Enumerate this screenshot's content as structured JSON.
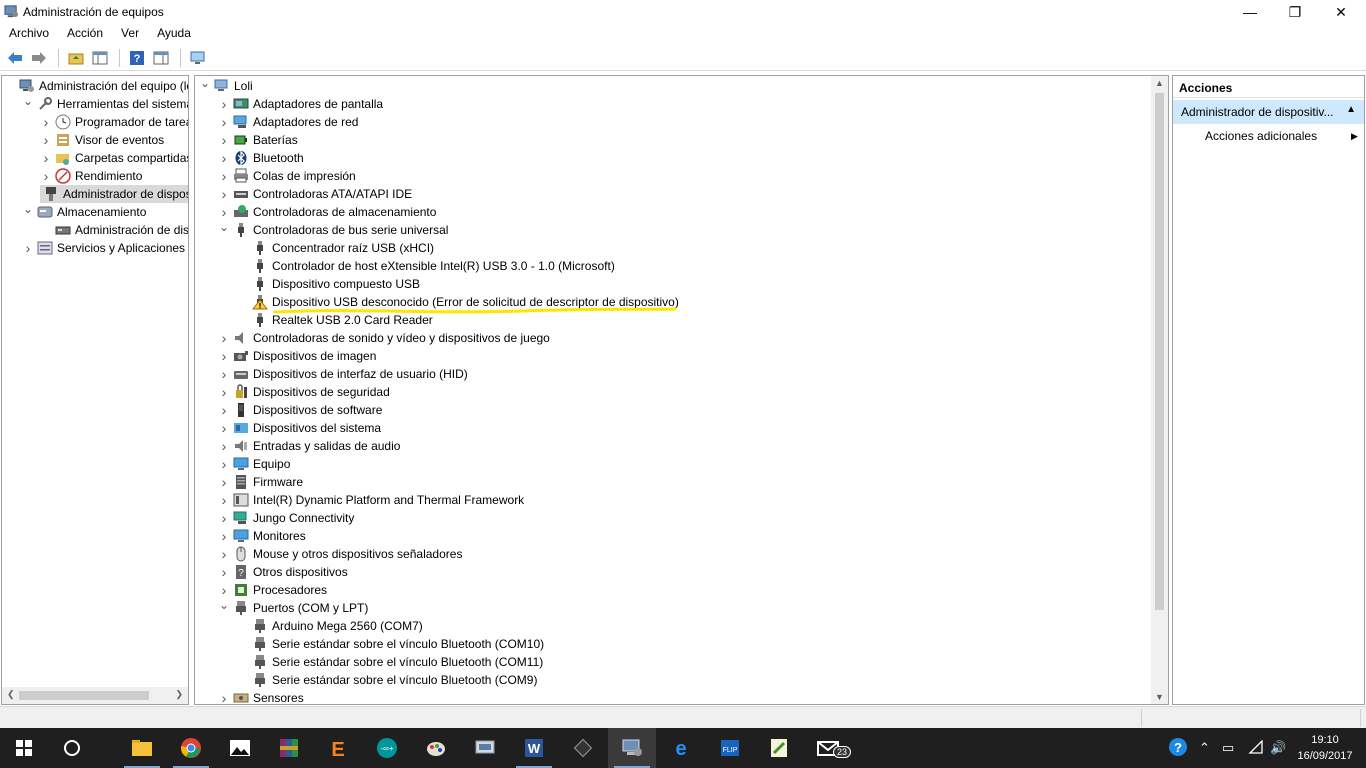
{
  "window": {
    "title": "Administración de equipos"
  },
  "menu": [
    "Archivo",
    "Acción",
    "Ver",
    "Ayuda"
  ],
  "left_tree": [
    {
      "label": "Administración del equipo (local)",
      "level": 0,
      "expander": "",
      "icon": "computer-management-icon"
    },
    {
      "label": "Herramientas del sistema",
      "level": 1,
      "expander": "open",
      "icon": "tools-icon"
    },
    {
      "label": "Programador de tareas",
      "level": 2,
      "expander": "closed",
      "icon": "clock-icon"
    },
    {
      "label": "Visor de eventos",
      "level": 2,
      "expander": "closed",
      "icon": "event-viewer-icon"
    },
    {
      "label": "Carpetas compartidas",
      "level": 2,
      "expander": "closed",
      "icon": "shared-folder-icon"
    },
    {
      "label": "Rendimiento",
      "level": 2,
      "expander": "closed",
      "icon": "performance-icon"
    },
    {
      "label": "Administrador de dispositivos",
      "level": 2,
      "expander": "",
      "icon": "device-manager-icon",
      "selected": true
    },
    {
      "label": "Almacenamiento",
      "level": 1,
      "expander": "open",
      "icon": "storage-icon"
    },
    {
      "label": "Administración de discos",
      "level": 2,
      "expander": "",
      "icon": "disk-icon"
    },
    {
      "label": "Servicios y Aplicaciones",
      "level": 1,
      "expander": "closed",
      "icon": "services-icon"
    }
  ],
  "device_tree": [
    {
      "label": "Loli",
      "level": 0,
      "expander": "open",
      "icon": "computer-icon"
    },
    {
      "label": "Adaptadores de pantalla",
      "level": 1,
      "expander": "closed",
      "icon": "display-adapter-icon"
    },
    {
      "label": "Adaptadores de red",
      "level": 1,
      "expander": "closed",
      "icon": "network-adapter-icon"
    },
    {
      "label": "Baterías",
      "level": 1,
      "expander": "closed",
      "icon": "battery-icon"
    },
    {
      "label": "Bluetooth",
      "level": 1,
      "expander": "closed",
      "icon": "bluetooth-icon"
    },
    {
      "label": "Colas de impresión",
      "level": 1,
      "expander": "closed",
      "icon": "print-queue-icon"
    },
    {
      "label": "Controladoras ATA/ATAPI IDE",
      "level": 1,
      "expander": "closed",
      "icon": "ide-controller-icon"
    },
    {
      "label": "Controladoras de almacenamiento",
      "level": 1,
      "expander": "closed",
      "icon": "storage-controller-icon"
    },
    {
      "label": "Controladoras de bus serie universal",
      "level": 1,
      "expander": "open",
      "icon": "usb-icon"
    },
    {
      "label": "Concentrador raíz USB (xHCI)",
      "level": 2,
      "expander": "",
      "icon": "usb-icon"
    },
    {
      "label": "Controlador de host eXtensible Intel(R) USB 3.0 - 1.0 (Microsoft)",
      "level": 2,
      "expander": "",
      "icon": "usb-icon"
    },
    {
      "label": "Dispositivo compuesto USB",
      "level": 2,
      "expander": "",
      "icon": "usb-icon"
    },
    {
      "label": "Dispositivo USB desconocido (Error de solicitud de descriptor de dispositivo)",
      "level": 2,
      "expander": "",
      "icon": "warning-icon"
    },
    {
      "label": "Realtek USB 2.0 Card Reader",
      "level": 2,
      "expander": "",
      "icon": "usb-icon"
    },
    {
      "label": "Controladoras de sonido y vídeo y dispositivos de juego",
      "level": 1,
      "expander": "closed",
      "icon": "speaker-icon"
    },
    {
      "label": "Dispositivos de imagen",
      "level": 1,
      "expander": "closed",
      "icon": "camera-icon"
    },
    {
      "label": "Dispositivos de interfaz de usuario (HID)",
      "level": 1,
      "expander": "closed",
      "icon": "hid-icon"
    },
    {
      "label": "Dispositivos de seguridad",
      "level": 1,
      "expander": "closed",
      "icon": "security-device-icon"
    },
    {
      "label": "Dispositivos de software",
      "level": 1,
      "expander": "closed",
      "icon": "software-device-icon"
    },
    {
      "label": "Dispositivos del sistema",
      "level": 1,
      "expander": "closed",
      "icon": "system-device-icon"
    },
    {
      "label": "Entradas y salidas de audio",
      "level": 1,
      "expander": "closed",
      "icon": "audio-io-icon"
    },
    {
      "label": "Equipo",
      "level": 1,
      "expander": "closed",
      "icon": "monitor-icon"
    },
    {
      "label": "Firmware",
      "level": 1,
      "expander": "closed",
      "icon": "firmware-icon"
    },
    {
      "label": "Intel(R) Dynamic Platform and Thermal Framework",
      "level": 1,
      "expander": "closed",
      "icon": "thermal-icon"
    },
    {
      "label": "Jungo Connectivity",
      "level": 1,
      "expander": "closed",
      "icon": "jungo-icon"
    },
    {
      "label": "Monitores",
      "level": 1,
      "expander": "closed",
      "icon": "monitor-icon"
    },
    {
      "label": "Mouse y otros dispositivos señaladores",
      "level": 1,
      "expander": "closed",
      "icon": "mouse-icon"
    },
    {
      "label": "Otros dispositivos",
      "level": 1,
      "expander": "closed",
      "icon": "unknown-device-icon"
    },
    {
      "label": "Procesadores",
      "level": 1,
      "expander": "closed",
      "icon": "processor-icon"
    },
    {
      "label": "Puertos (COM y LPT)",
      "level": 1,
      "expander": "open",
      "icon": "port-icon"
    },
    {
      "label": "Arduino Mega 2560 (COM7)",
      "level": 2,
      "expander": "",
      "icon": "port-icon"
    },
    {
      "label": "Serie estándar sobre el vínculo Bluetooth (COM10)",
      "level": 2,
      "expander": "",
      "icon": "port-icon"
    },
    {
      "label": "Serie estándar sobre el vínculo Bluetooth (COM11)",
      "level": 2,
      "expander": "",
      "icon": "port-icon"
    },
    {
      "label": "Serie estándar sobre el vínculo Bluetooth (COM9)",
      "level": 2,
      "expander": "",
      "icon": "port-icon"
    },
    {
      "label": "Sensores",
      "level": 1,
      "expander": "closed",
      "icon": "sensor-icon"
    }
  ],
  "actions": {
    "header": "Acciones",
    "section": "Administrador de dispositiv...",
    "item": "Acciones adicionales"
  },
  "taskbar": {
    "apps": [
      "start-icon",
      "cortana-icon",
      "file-explorer-icon",
      "chrome-icon",
      "photos-icon",
      "winrar-icon",
      "eclipse-icon",
      "arduino-icon",
      "paint-icon",
      "device-icon",
      "word-icon",
      "chip-icon",
      "computer-management-icon",
      "edge-icon",
      "flip-icon",
      "notepad-icon",
      "mail-icon"
    ],
    "mail_badge": "23",
    "time": "19:10",
    "date": "16/09/2017"
  },
  "colors": {
    "highlight": "#ffe600",
    "selection": "#d9d9d9",
    "actions_section": "#cde8ff",
    "taskbar": "#1f1f1f"
  }
}
